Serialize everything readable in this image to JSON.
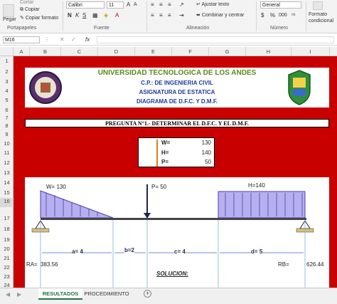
{
  "ribbon": {
    "paste_label": "Pegar",
    "cut_label": "Cortar",
    "copy_label": "Copiar",
    "copy_format_label": "Copiar formato",
    "clipboard_group": "Portapapeles",
    "font_name": "Calibri",
    "font_size": "11",
    "bold": "N",
    "italic": "K",
    "underline": "S",
    "font_group": "Fuente",
    "wrap_text": "Ajustar texto",
    "merge_center": "Combinar y centrar",
    "alignment_group": "Alineación",
    "number_format": "General",
    "percent": "%",
    "thousands": "000",
    "number_group": "Número",
    "conditional_format": "Formato condicional"
  },
  "formula_bar": {
    "name_box": "M16",
    "fx": "fx",
    "formula": ""
  },
  "columns": [
    "A",
    "B",
    "C",
    "D",
    "E",
    "F",
    "G",
    "H",
    "I"
  ],
  "rows": [
    "1",
    "2",
    "3",
    "4",
    "5",
    "6",
    "7",
    "8",
    "9",
    "10",
    "11",
    "12",
    "13",
    "14",
    "15",
    "16",
    "17",
    "18",
    "19",
    "20",
    "21",
    "22",
    "23",
    "24"
  ],
  "header": {
    "university": "UNIVERSIDAD TECNOLOGICA DE LOS ANDES",
    "program": "C.P.: DE INGENIERIA CIVIL",
    "course": "ASIGNATURA DE ESTATICA",
    "diagram": "DIAGRAMA DE D.F.C. Y D.M.F."
  },
  "question": "PREGUNTA N°1.- DETERMINAR EL D.F.C. Y EL D.M.F.",
  "loads": [
    {
      "name": "W=",
      "value": "130"
    },
    {
      "name": "H=",
      "value": "140"
    },
    {
      "name": "P=",
      "value": "50"
    }
  ],
  "beam": {
    "w_label": "W=  130",
    "p_label": "P= 50",
    "h_label": "H=140",
    "dims": [
      "a= 4",
      "b=2",
      "c= 4",
      "d= 5"
    ],
    "ra_label": "RA=",
    "ra_value": "383.56",
    "rb_label": "RB=",
    "rb_value": "626.44",
    "solution": "SOLUCION:"
  },
  "tabs": [
    "RESULTADOS",
    "PROCEDIMIENTO"
  ],
  "colors": {
    "sheet_red": "#c80000",
    "title_blue": "#1f3b9a",
    "load_fill": "#b6b0ee",
    "load_stroke": "#4a3fb5",
    "tab_green": "#217346"
  }
}
